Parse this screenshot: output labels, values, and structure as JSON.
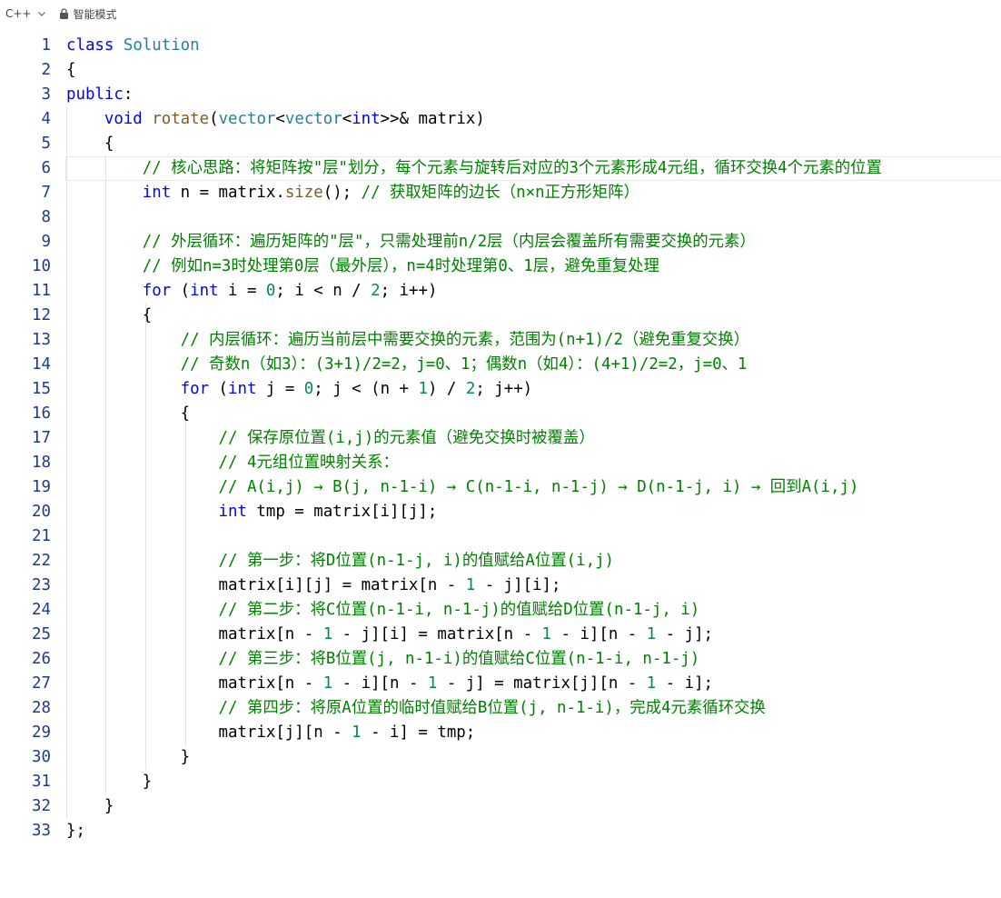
{
  "toolbar": {
    "language": "C++",
    "mode": "智能模式"
  },
  "colors": {
    "keyword": "#0000ff",
    "type": "#267f99",
    "function": "#795e26",
    "comment": "#008000",
    "number": "#098658",
    "line_number": "#1e3a8a"
  },
  "editor": {
    "active_line": 6,
    "lines": [
      {
        "n": "1",
        "tokens": [
          [
            "kw",
            "class"
          ],
          [
            "tx",
            " "
          ],
          [
            "ty",
            "Solution"
          ]
        ]
      },
      {
        "n": "2",
        "tokens": [
          [
            "tx",
            "{"
          ]
        ]
      },
      {
        "n": "3",
        "tokens": [
          [
            "kw",
            "public"
          ],
          [
            "tx",
            ":"
          ]
        ]
      },
      {
        "n": "4",
        "tokens": [
          [
            "tx",
            "    "
          ],
          [
            "kw",
            "void"
          ],
          [
            "tx",
            " "
          ],
          [
            "fn",
            "rotate"
          ],
          [
            "tx",
            "("
          ],
          [
            "ty",
            "vector"
          ],
          [
            "tx",
            "<"
          ],
          [
            "ty",
            "vector"
          ],
          [
            "tx",
            "<"
          ],
          [
            "kw",
            "int"
          ],
          [
            "tx",
            ">>& matrix)"
          ]
        ]
      },
      {
        "n": "5",
        "tokens": [
          [
            "tx",
            "    {"
          ]
        ]
      },
      {
        "n": "6",
        "tokens": [
          [
            "tx",
            "        "
          ],
          [
            "cm",
            "// 核心思路：将矩阵按\"层\"划分，每个元素与旋转后对应的3个元素形成4元组，循环交换4个元素的位置"
          ]
        ]
      },
      {
        "n": "7",
        "tokens": [
          [
            "tx",
            "        "
          ],
          [
            "kw",
            "int"
          ],
          [
            "tx",
            " n = matrix."
          ],
          [
            "fn",
            "size"
          ],
          [
            "tx",
            "(); "
          ],
          [
            "cm",
            "// 获取矩阵的边长（n×n正方形矩阵）"
          ]
        ]
      },
      {
        "n": "8",
        "tokens": []
      },
      {
        "n": "9",
        "tokens": [
          [
            "tx",
            "        "
          ],
          [
            "cm",
            "// 外层循环：遍历矩阵的\"层\"，只需处理前n/2层（内层会覆盖所有需要交换的元素）"
          ]
        ]
      },
      {
        "n": "10",
        "tokens": [
          [
            "tx",
            "        "
          ],
          [
            "cm",
            "// 例如n=3时处理第0层（最外层），n=4时处理第0、1层，避免重复处理"
          ]
        ]
      },
      {
        "n": "11",
        "tokens": [
          [
            "tx",
            "        "
          ],
          [
            "kw",
            "for"
          ],
          [
            "tx",
            " ("
          ],
          [
            "kw",
            "int"
          ],
          [
            "tx",
            " i = "
          ],
          [
            "nm",
            "0"
          ],
          [
            "tx",
            "; i < n / "
          ],
          [
            "nm",
            "2"
          ],
          [
            "tx",
            "; i++)"
          ]
        ]
      },
      {
        "n": "12",
        "tokens": [
          [
            "tx",
            "        {"
          ]
        ]
      },
      {
        "n": "13",
        "tokens": [
          [
            "tx",
            "            "
          ],
          [
            "cm",
            "// 内层循环：遍历当前层中需要交换的元素，范围为(n+1)/2（避免重复交换）"
          ]
        ]
      },
      {
        "n": "14",
        "tokens": [
          [
            "tx",
            "            "
          ],
          [
            "cm",
            "// 奇数n（如3）：(3+1)/2=2，j=0、1；偶数n（如4）：(4+1)/2=2，j=0、1"
          ]
        ]
      },
      {
        "n": "15",
        "tokens": [
          [
            "tx",
            "            "
          ],
          [
            "kw",
            "for"
          ],
          [
            "tx",
            " ("
          ],
          [
            "kw",
            "int"
          ],
          [
            "tx",
            " j = "
          ],
          [
            "nm",
            "0"
          ],
          [
            "tx",
            "; j < (n + "
          ],
          [
            "nm",
            "1"
          ],
          [
            "tx",
            ") / "
          ],
          [
            "nm",
            "2"
          ],
          [
            "tx",
            "; j++)"
          ]
        ]
      },
      {
        "n": "16",
        "tokens": [
          [
            "tx",
            "            {"
          ]
        ]
      },
      {
        "n": "17",
        "tokens": [
          [
            "tx",
            "                "
          ],
          [
            "cm",
            "// 保存原位置(i,j)的元素值（避免交换时被覆盖）"
          ]
        ]
      },
      {
        "n": "18",
        "tokens": [
          [
            "tx",
            "                "
          ],
          [
            "cm",
            "// 4元组位置映射关系："
          ]
        ]
      },
      {
        "n": "19",
        "tokens": [
          [
            "tx",
            "                "
          ],
          [
            "cm",
            "// A(i,j) → B(j, n-1-i) → C(n-1-i, n-1-j) → D(n-1-j, i) → 回到A(i,j)"
          ]
        ]
      },
      {
        "n": "20",
        "tokens": [
          [
            "tx",
            "                "
          ],
          [
            "kw",
            "int"
          ],
          [
            "tx",
            " tmp = matrix[i][j];"
          ]
        ]
      },
      {
        "n": "21",
        "tokens": []
      },
      {
        "n": "22",
        "tokens": [
          [
            "tx",
            "                "
          ],
          [
            "cm",
            "// 第一步：将D位置(n-1-j, i)的值赋给A位置(i,j)"
          ]
        ]
      },
      {
        "n": "23",
        "tokens": [
          [
            "tx",
            "                matrix[i][j] = matrix[n - "
          ],
          [
            "nm",
            "1"
          ],
          [
            "tx",
            " - j][i];"
          ]
        ]
      },
      {
        "n": "24",
        "tokens": [
          [
            "tx",
            "                "
          ],
          [
            "cm",
            "// 第二步：将C位置(n-1-i, n-1-j)的值赋给D位置(n-1-j, i)"
          ]
        ]
      },
      {
        "n": "25",
        "tokens": [
          [
            "tx",
            "                matrix[n - "
          ],
          [
            "nm",
            "1"
          ],
          [
            "tx",
            " - j][i] = matrix[n - "
          ],
          [
            "nm",
            "1"
          ],
          [
            "tx",
            " - i][n - "
          ],
          [
            "nm",
            "1"
          ],
          [
            "tx",
            " - j];"
          ]
        ]
      },
      {
        "n": "26",
        "tokens": [
          [
            "tx",
            "                "
          ],
          [
            "cm",
            "// 第三步：将B位置(j, n-1-i)的值赋给C位置(n-1-i, n-1-j)"
          ]
        ]
      },
      {
        "n": "27",
        "tokens": [
          [
            "tx",
            "                matrix[n - "
          ],
          [
            "nm",
            "1"
          ],
          [
            "tx",
            " - i][n - "
          ],
          [
            "nm",
            "1"
          ],
          [
            "tx",
            " - j] = matrix[j][n - "
          ],
          [
            "nm",
            "1"
          ],
          [
            "tx",
            " - i];"
          ]
        ]
      },
      {
        "n": "28",
        "tokens": [
          [
            "tx",
            "                "
          ],
          [
            "cm",
            "// 第四步：将原A位置的临时值赋给B位置(j, n-1-i)，完成4元素循环交换"
          ]
        ]
      },
      {
        "n": "29",
        "tokens": [
          [
            "tx",
            "                matrix[j][n - "
          ],
          [
            "nm",
            "1"
          ],
          [
            "tx",
            " - i] = tmp;"
          ]
        ]
      },
      {
        "n": "30",
        "tokens": [
          [
            "tx",
            "            }"
          ]
        ]
      },
      {
        "n": "31",
        "tokens": [
          [
            "tx",
            "        }"
          ]
        ]
      },
      {
        "n": "32",
        "tokens": [
          [
            "tx",
            "    }"
          ]
        ]
      },
      {
        "n": "33",
        "tokens": [
          [
            "tx",
            "};"
          ]
        ]
      }
    ]
  }
}
